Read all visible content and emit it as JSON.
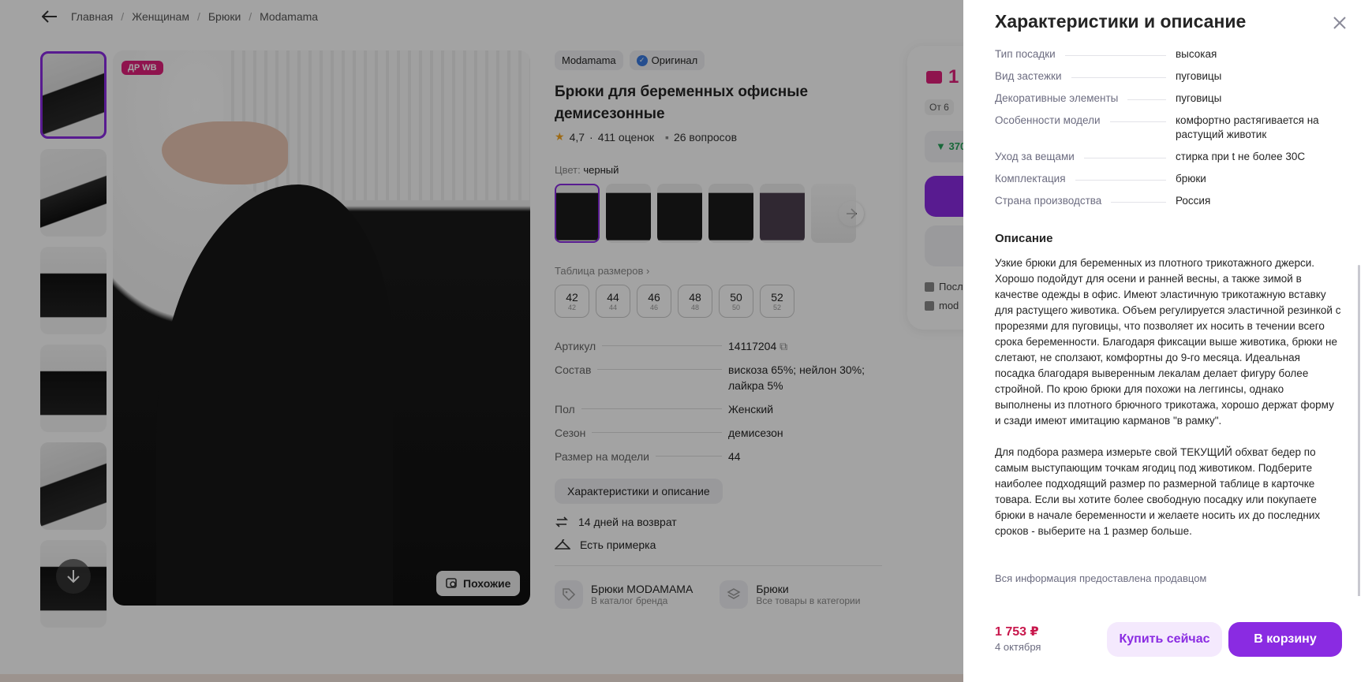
{
  "breadcrumbs": [
    "Главная",
    "Женщинам",
    "Брюки",
    "Modamama"
  ],
  "gallery": {
    "badge": "ДР WB",
    "similar_label": "Похожие"
  },
  "product": {
    "brand": "Modamama",
    "original_label": "Оригинал",
    "title": "Брюки для беременных офисные демисезонные",
    "rating": "4,7",
    "reviews": "411 оценок",
    "questions": "26 вопросов",
    "color_label": "Цвет:",
    "color_value": "черный",
    "sizes_link": "Таблица размеров",
    "sizes": [
      {
        "main": "42",
        "sub": "42"
      },
      {
        "main": "44",
        "sub": "44"
      },
      {
        "main": "46",
        "sub": "46"
      },
      {
        "main": "48",
        "sub": "48"
      },
      {
        "main": "50",
        "sub": "50"
      },
      {
        "main": "52",
        "sub": "52"
      }
    ],
    "specs": [
      {
        "k": "Артикул",
        "v": "14117204"
      },
      {
        "k": "Состав",
        "v": "вискоза 65%; нейлон 30%; лайкра 5%"
      },
      {
        "k": "Пол",
        "v": "Женский"
      },
      {
        "k": "Сезон",
        "v": "демисезон"
      },
      {
        "k": "Размер на модели",
        "v": "44"
      }
    ],
    "desc_button": "Характеристики и описание",
    "features": [
      "14 дней на возврат",
      "Есть примерка"
    ],
    "brand_links": [
      {
        "title": "Брюки MODAMAMA",
        "sub": "В каталог бренда"
      },
      {
        "title": "Брюки",
        "sub": "Все товары в категории"
      }
    ]
  },
  "buy_card": {
    "price_partial": "1",
    "ot_partial": "От 6",
    "delta_partial": "▼ 370",
    "line1_partial": "Посл",
    "line2_partial": "mod"
  },
  "panel": {
    "title": "Характеристики и описание",
    "specs": [
      {
        "k": "Тип посадки",
        "v": "высокая"
      },
      {
        "k": "Вид застежки",
        "v": "пуговицы"
      },
      {
        "k": "Декоративные элементы",
        "v": "пуговицы"
      },
      {
        "k": "Особенности модели",
        "v": "комфортно растягивается на растущий животик"
      },
      {
        "k": "Уход за вещами",
        "v": "стирка при t не более 30С"
      },
      {
        "k": "Комплектация",
        "v": "брюки"
      },
      {
        "k": "Страна производства",
        "v": "Россия"
      }
    ],
    "desc_title": "Описание",
    "description": "Узкие брюки для беременных из плотного трикотажного джерси. Хорошо подойдут для осени и ранней весны, а также зимой в качестве одежды в офис. Имеют эластичную трикотажную вставку для растущего животика. Объем регулируется эластичной резинкой с прорезями для пуговицы, что позволяет их носить в течении всего срока беременности. Благодаря фиксации выше животика, брюки не слетают, не сползают, комфортны до 9-го месяца. Идеальная посадка благодаря выверенным лекалам делает фигуру более стройной. По крою брюки для похожи на леггинсы, однако выполнены из плотного брючного трикотажа, хорошо держат форму и сзади имеют имитацию карманов \"в рамку\".\n\nДля подбора размера измерьте свой ТЕКУЩИЙ обхват бедер по самым выступающим точкам ягодиц под животиком. Подберите наиболее подходящий размер по размерной таблице в карточке товара. Если вы хотите более свободную посадку или покупаете брюки в начале беременности и желаете носить их до последних сроков - выберите на 1 размер больше.",
    "note": "Вся информация предоставлена продавцом",
    "price": "1 753 ₽",
    "date": "4 октября",
    "buy_now": "Купить сейчас",
    "cart": "В корзину"
  }
}
